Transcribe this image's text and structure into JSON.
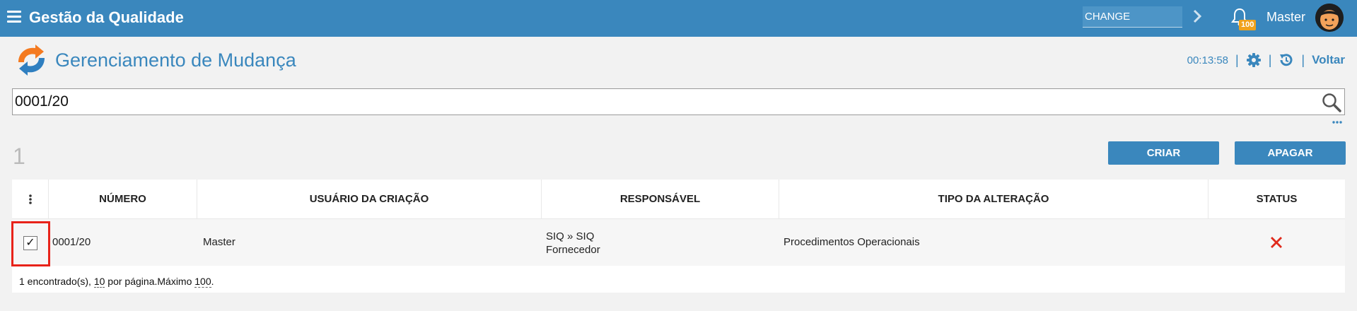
{
  "topbar": {
    "app_title": "Gestão da Qualidade",
    "module_value": "CHANGE",
    "notification_count": "100",
    "username": "Master",
    "bar_color": "#3a87bd"
  },
  "header": {
    "title": "Gerenciamento de Mudança",
    "timer": "00:13:58",
    "back_label": "Voltar"
  },
  "search": {
    "value": "0001/20"
  },
  "toolbar": {
    "result_count": "1",
    "create_label": "CRIAR",
    "delete_label": "APAGAR"
  },
  "table": {
    "columns": [
      "NÚMERO",
      "USUÁRIO DA CRIAÇÃO",
      "RESPONSÁVEL",
      "TIPO DA ALTERAÇÃO",
      "STATUS"
    ],
    "rows": [
      {
        "checked": "✓",
        "numero": "0001/20",
        "usuario": "Master",
        "responsavel_line1": "SIQ » SIQ",
        "responsavel_line2": "Fornecedor",
        "tipo": "Procedimentos Operacionais",
        "status_icon": "red-x-icon"
      }
    ],
    "footer": {
      "found": "1 encontrado(s), ",
      "per_page_value": "10",
      "per_page_text": " por página.Máximo ",
      "max_value": "100",
      "end": "."
    }
  }
}
